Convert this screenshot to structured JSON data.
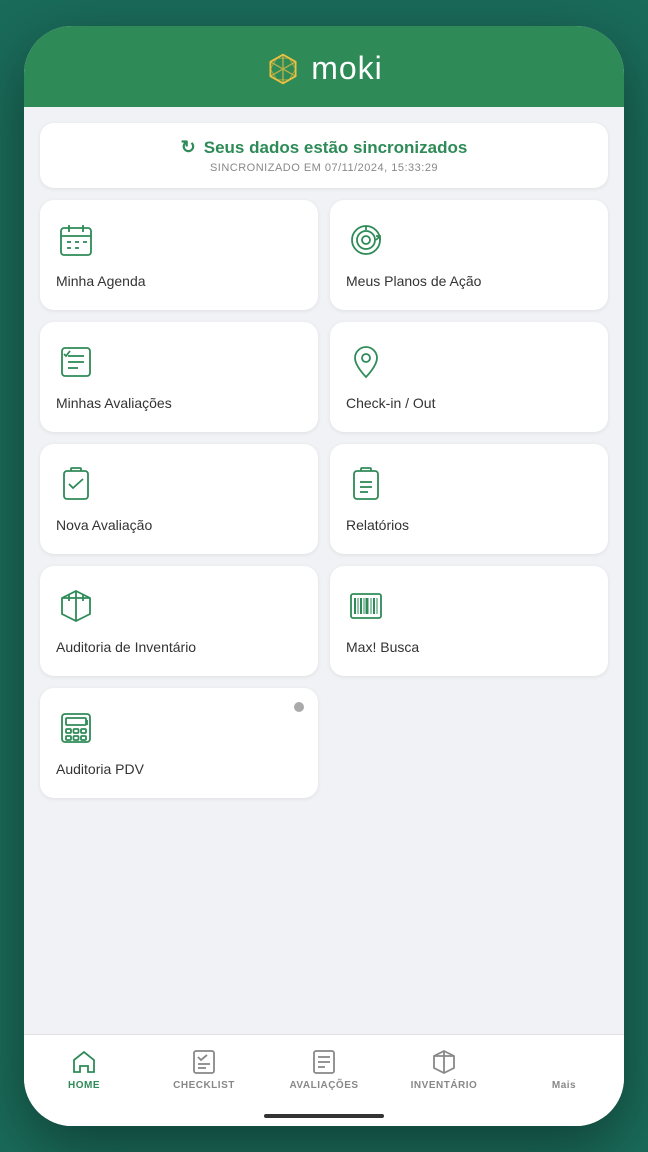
{
  "header": {
    "title": "moki",
    "logo_alt": "moki logo"
  },
  "sync": {
    "title": "Seus dados estão sincronizados",
    "subtitle": "SINCRONIZADO EM 07/11/2024, 15:33:29",
    "icon": "↻"
  },
  "grid_items": [
    {
      "id": "agenda",
      "label": "Minha Agenda",
      "icon": "calendar"
    },
    {
      "id": "planos",
      "label": "Meus Planos de Ação",
      "icon": "target"
    },
    {
      "id": "avaliacoes",
      "label": "Minhas Avaliações",
      "icon": "list-check"
    },
    {
      "id": "checkin",
      "label": "Check-in / Out",
      "icon": "location"
    },
    {
      "id": "nova-avaliacao",
      "label": "Nova Avaliação",
      "icon": "clipboard-check"
    },
    {
      "id": "relatorios",
      "label": "Relatórios",
      "icon": "clipboard-list"
    },
    {
      "id": "inventario",
      "label": "Auditoria de Inventário",
      "icon": "box"
    },
    {
      "id": "busca",
      "label": "Max! Busca",
      "icon": "barcode"
    },
    {
      "id": "pdv",
      "label": "Auditoria PDV",
      "icon": "calculator",
      "badge": true
    }
  ],
  "nav": {
    "items": [
      {
        "id": "home",
        "label": "HOME",
        "icon": "home",
        "active": true
      },
      {
        "id": "checklist",
        "label": "CHECKLIST",
        "icon": "checklist",
        "active": false
      },
      {
        "id": "avaliacoes",
        "label": "AVALIAÇÕES",
        "icon": "avaliacoes",
        "active": false
      },
      {
        "id": "inventario",
        "label": "INVENTÁRIO",
        "icon": "box-nav",
        "active": false
      },
      {
        "id": "mais",
        "label": "Mais",
        "icon": "more",
        "active": false
      }
    ]
  }
}
